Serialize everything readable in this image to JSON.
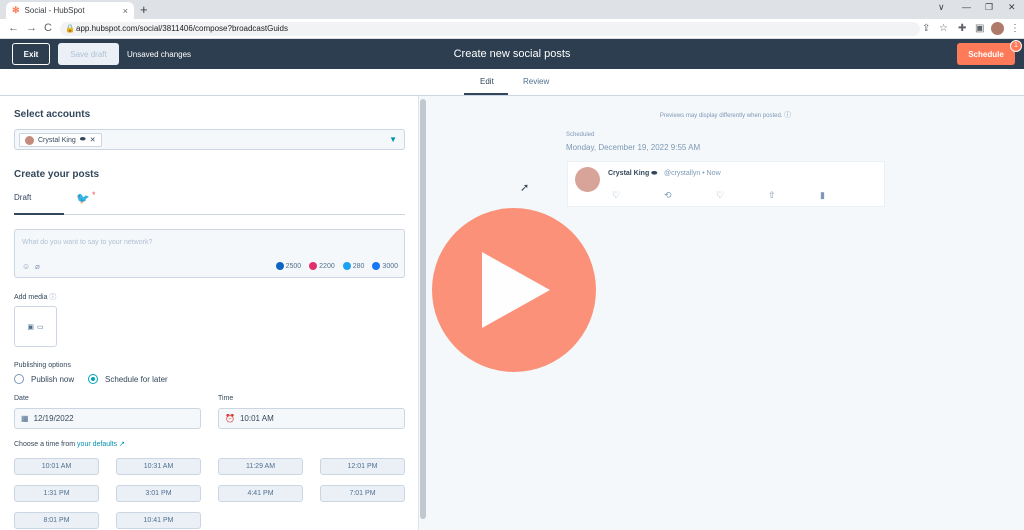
{
  "browser": {
    "tab_title": "Social - HubSpot",
    "tab_close": "×",
    "new_tab": "+",
    "url": "app.hubspot.com/social/3811406/compose?broadcastGuids",
    "back": "←",
    "forward": "→",
    "reload": "C",
    "minimize": "—",
    "restore": "❐",
    "close": "✕",
    "collapse": "∨"
  },
  "header": {
    "exit_label": "Exit",
    "save_draft_label": "Save draft",
    "unsaved_text": "Unsaved changes",
    "title": "Create new social posts",
    "schedule_label": "Schedule",
    "badge_count": "1"
  },
  "tabs": [
    {
      "label": "Edit",
      "active": true
    },
    {
      "label": "Review",
      "active": false
    }
  ],
  "editor": {
    "select_accounts_heading": "Select accounts",
    "selected_account": "Crystal King",
    "create_posts_heading": "Create your posts",
    "draft_tab": "Draft",
    "compose_placeholder": "What do you want to say to your network?",
    "counters": [
      {
        "value": "2500",
        "color": "#0a66c2"
      },
      {
        "value": "2200",
        "color": "#e1306c"
      },
      {
        "value": "280",
        "color": "#1da1f2"
      },
      {
        "value": "3000",
        "color": "#1877f2"
      }
    ],
    "add_media_label": "Add media",
    "publishing_options_label": "Publishing options",
    "publish_now": "Publish now",
    "schedule_later": "Schedule for later",
    "date_label": "Date",
    "date_value": "12/19/2022",
    "time_label": "Time",
    "time_value": "10:01 AM",
    "defaults_prefix": "Choose a time from",
    "defaults_link": "your defaults",
    "time_chips": [
      "10:01 AM",
      "10:31 AM",
      "11:29 AM",
      "12:01 PM",
      "1:31 PM",
      "3:01 PM",
      "4:41 PM",
      "7:01 PM",
      "8:01 PM",
      "10:41 PM"
    ]
  },
  "preview": {
    "note": "Previews may display differently when posted.",
    "scheduled_label": "Scheduled",
    "scheduled_date": "Monday, December 19, 2022 9:55 AM",
    "tweet_name": "Crystal King",
    "tweet_handle": "@crystallyn • Now"
  },
  "colors": {
    "accent": "#ff7a59",
    "header_bg": "#2d3e50",
    "play_button": "#fb8c72"
  }
}
